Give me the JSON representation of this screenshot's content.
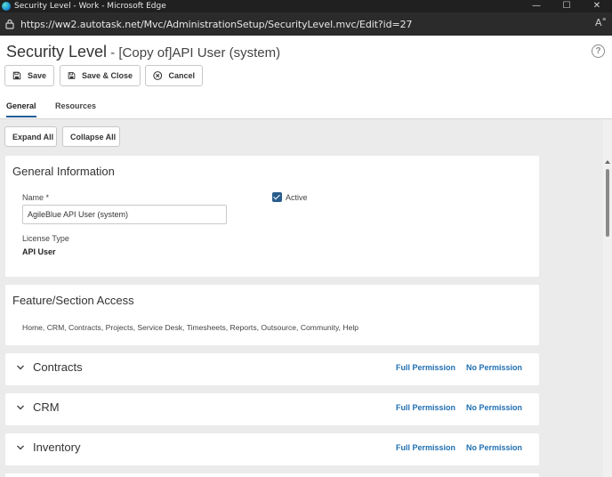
{
  "browser": {
    "window_title": "Security Level - Work - Microsoft Edge",
    "url": "https://ww2.autotask.net/Mvc/AdministrationSetup/SecurityLevel.mvc/Edit?id=27",
    "read_aloud_label": "A˭",
    "minimize": "—",
    "maximize": "☐",
    "close": "✕"
  },
  "header": {
    "title": "Security Level",
    "subtitle": " - [Copy of]API User (system)",
    "help_label": "?"
  },
  "toolbar": {
    "save_label": "Save",
    "save_close_label": "Save & Close",
    "cancel_label": "Cancel"
  },
  "tabs": [
    {
      "label": "General",
      "active": true
    },
    {
      "label": "Resources",
      "active": false
    }
  ],
  "actions": {
    "expand_all": "Expand All",
    "collapse_all": "Collapse All"
  },
  "general_info": {
    "title": "General Information",
    "name_label": "Name",
    "required_mark": "*",
    "name_value": "AgileBlue API User (system)",
    "active_label": "Active",
    "active_checked": true,
    "license_type_label": "License Type",
    "license_type_value": "API User"
  },
  "feature_access": {
    "title": "Feature/Section Access",
    "list": "Home, CRM, Contracts, Projects, Service Desk, Timesheets, Reports, Outsource, Community, Help"
  },
  "sections": [
    {
      "title": "Contracts",
      "full_permission": "Full Permission",
      "no_permission": "No Permission"
    },
    {
      "title": "CRM",
      "full_permission": "Full Permission",
      "no_permission": "No Permission"
    },
    {
      "title": "Inventory",
      "full_permission": "Full Permission",
      "no_permission": "No Permission"
    }
  ],
  "colors": {
    "accent": "#1f5f98",
    "link": "#1f6fb2",
    "checkbox": "#2a5d8c",
    "content_bg": "#ebebeb"
  },
  "icons": {
    "save": "floppy-disk-icon",
    "cancel": "x-circle-icon",
    "section_toggle": "chevron-down-icon"
  }
}
